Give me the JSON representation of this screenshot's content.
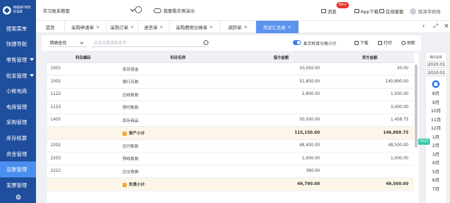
{
  "sidebar": {
    "logo_title": "畅捷通T财税",
    "logo_sub": "标准版",
    "items": [
      {
        "label": "搜索菜单",
        "caret": false,
        "active": false
      },
      {
        "label": "快捷导航",
        "caret": false,
        "active": false
      },
      {
        "label": "零售管理",
        "caret": true,
        "active": false
      },
      {
        "label": "批发管理",
        "caret": true,
        "active": false
      },
      {
        "label": "小帐电商",
        "caret": false,
        "active": false
      },
      {
        "label": "电商管理",
        "caret": false,
        "active": false
      },
      {
        "label": "采购管理",
        "caret": false,
        "active": false
      },
      {
        "label": "库存核算",
        "caret": false,
        "active": false
      },
      {
        "label": "资金管理",
        "caret": false,
        "active": false
      },
      {
        "label": "总账管理",
        "caret": false,
        "active": true
      },
      {
        "label": "发票管理",
        "caret": false,
        "active": false
      }
    ]
  },
  "topbar": {
    "account": "实习账系教套",
    "demo": "我要看实例演示",
    "message": "消息",
    "badge": "99+",
    "app_download": "App下载",
    "service": "在线客服",
    "user": "徐泽华修改"
  },
  "tabs": [
    {
      "label": "首页",
      "closable": false,
      "active": false
    },
    {
      "label": "采购申请单",
      "closable": true,
      "active": false
    },
    {
      "label": "采购订单",
      "closable": true,
      "active": false
    },
    {
      "label": "进货单",
      "closable": true,
      "active": false
    },
    {
      "label": "采购费用分摊单",
      "closable": true,
      "active": false
    },
    {
      "label": "调货单",
      "closable": true,
      "active": false
    },
    {
      "label": "凭证汇总表",
      "closable": true,
      "active": true
    }
  ],
  "toolbar": {
    "search_mode": "精确查找",
    "search_placeholder": "点击设置搜索条件",
    "toggle_label": "显示科目分类小计",
    "download": "下载",
    "print": "打印",
    "refresh": "刷新"
  },
  "table": {
    "headers": [
      "科目编码",
      "科目名称",
      "借方金额",
      "贷方金额"
    ],
    "rows": [
      {
        "code": "1001",
        "name": "库存现金",
        "debit": "10,050.00",
        "credit": "20.00",
        "subtotal": false
      },
      {
        "code": "1002",
        "name": "银行存款",
        "debit": "51,800.00",
        "credit": "140,890.00",
        "subtotal": false
      },
      {
        "code": "1122",
        "name": "应收账款",
        "debit": "2,800.00",
        "credit": "1,500.00",
        "subtotal": false
      },
      {
        "code": "1123",
        "name": "预付账款",
        "debit": "",
        "credit": "3,000.00",
        "subtotal": false
      },
      {
        "code": "1405",
        "name": "库存商品",
        "debit": "50,500.00",
        "credit": "1,458.75",
        "subtotal": false
      },
      {
        "code": "",
        "name": "资产小计",
        "debit": "115,150.00",
        "credit": "146,868.75",
        "subtotal": true
      },
      {
        "code": "2202",
        "name": "应付账款",
        "debit": "48,400.00",
        "credit": "48,500.00",
        "subtotal": false
      },
      {
        "code": "2203",
        "name": "预收账款",
        "debit": "1,000.00",
        "credit": "1,000.00",
        "subtotal": false
      },
      {
        "code": "2221",
        "name": "应交税费",
        "debit": "390.00",
        "credit": "",
        "subtotal": false
      },
      {
        "code": "",
        "name": "负债小计",
        "debit": "49,790.00",
        "credit": "49,500.00",
        "subtotal": true
      }
    ]
  },
  "period": {
    "title": "期间选择",
    "from": "2020.01",
    "to": "2020.01",
    "year_tag": "2021",
    "months": [
      "8月",
      "9月",
      "10月",
      "11月",
      "12月",
      "1月",
      "2月",
      "3月",
      "4月",
      "5月",
      "6月",
      "7月"
    ]
  },
  "colors": {
    "sidebar": "#1f4e9c",
    "accent": "#5b93ef",
    "subtotal_bg": "#fdf6e8",
    "badge": "#e8342f"
  }
}
